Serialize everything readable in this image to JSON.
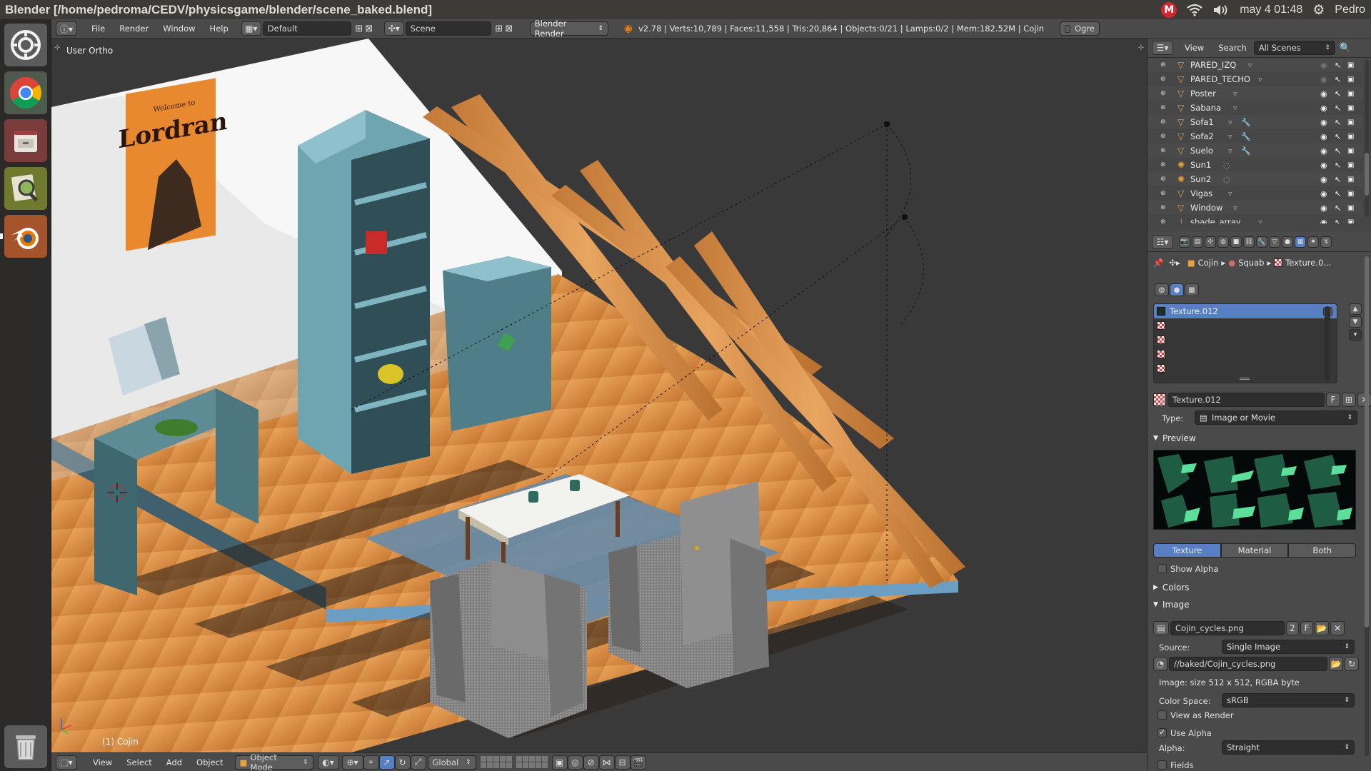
{
  "os_bar": {
    "window_title": "Blender [/home/pedroma/CEDV/physicsgame/blender/scene_baked.blend]",
    "mail_indicator": "M",
    "clock": "may  4 01:48",
    "user": "Pedro"
  },
  "launcher": {
    "items": [
      {
        "name": "ubuntu-settings",
        "icon": "gear-circle-icon"
      },
      {
        "name": "chrome",
        "icon": "chrome-icon"
      },
      {
        "name": "file-manager",
        "icon": "drawer-icon"
      },
      {
        "name": "image-viewer",
        "icon": "magnifier-icon"
      },
      {
        "name": "blender",
        "icon": "blender-icon"
      },
      {
        "name": "trash",
        "icon": "trash-icon"
      }
    ]
  },
  "info_header": {
    "menus": [
      "File",
      "Render",
      "Window",
      "Help"
    ],
    "layout": "Default",
    "scene": "Scene",
    "engine": "Blender Render",
    "stats": "v2.78 | Verts:10,789 | Faces:11,558 | Tris:20,864 | Objects:0/21 | Lamps:0/2 | Mem:182.52M | Cojin",
    "ogre_label": "Ogre"
  },
  "viewport": {
    "view_label": "User Ortho",
    "object_label": "(1) Cojin",
    "poster_text_small": "Welcome to",
    "poster_text": "Lordran"
  },
  "viewport_header": {
    "menus": [
      "View",
      "Select",
      "Add",
      "Object"
    ],
    "mode": "Object Mode",
    "orientation": "Global"
  },
  "outliner": {
    "menus": [
      "View",
      "Search"
    ],
    "filter": "All Scenes",
    "items": [
      {
        "name": "PARED_IZQ",
        "kind": "mesh",
        "modifier": false,
        "visible": false
      },
      {
        "name": "PARED_TECHO",
        "kind": "mesh",
        "modifier": false,
        "visible": false
      },
      {
        "name": "Poster",
        "kind": "mesh",
        "modifier": false,
        "visible": true
      },
      {
        "name": "Sabana",
        "kind": "mesh",
        "modifier": false,
        "visible": true
      },
      {
        "name": "Sofa1",
        "kind": "mesh",
        "modifier": true,
        "visible": true
      },
      {
        "name": "Sofa2",
        "kind": "mesh",
        "modifier": true,
        "visible": true
      },
      {
        "name": "Suelo",
        "kind": "mesh",
        "modifier": true,
        "visible": true
      },
      {
        "name": "Sun1",
        "kind": "lamp",
        "modifier": false,
        "visible": true
      },
      {
        "name": "Sun2",
        "kind": "lamp",
        "modifier": false,
        "visible": true
      },
      {
        "name": "Vigas",
        "kind": "mesh",
        "modifier": false,
        "visible": true
      },
      {
        "name": "Window",
        "kind": "mesh",
        "modifier": false,
        "visible": true
      },
      {
        "name": "shade_array",
        "kind": "empty",
        "modifier": false,
        "visible": true
      }
    ]
  },
  "properties": {
    "breadcrumb": [
      "Cojin",
      "Squab",
      "Texture.0..."
    ],
    "texture_slots": [
      "Texture.012",
      "",
      "",
      "",
      ""
    ],
    "texture_name": "Texture.012",
    "texture_fake_user": "F",
    "type_label": "Type:",
    "type_value": "Image or Movie",
    "preview_label": "Preview",
    "preview_tabs": [
      "Texture",
      "Material",
      "Both"
    ],
    "preview_active_tab": "Texture",
    "show_alpha_label": "Show Alpha",
    "colors_label": "Colors",
    "image_label": "Image",
    "image_name": "Cojin_cycles.png",
    "image_users": "2",
    "image_fake_user": "F",
    "source_label": "Source:",
    "source_value": "Single Image",
    "filepath": "//baked/Cojin_cycles.png",
    "image_info": "Image: size 512 x 512, RGBA byte",
    "colorspace_label": "Color Space:",
    "colorspace_value": "sRGB",
    "view_as_render_label": "View as Render",
    "view_as_render": false,
    "use_alpha_label": "Use Alpha",
    "use_alpha": true,
    "alpha_label": "Alpha:",
    "alpha_value": "Straight",
    "fields_label": "Fields",
    "fields": false
  },
  "colors": {
    "selection_blue": "#5680c2",
    "wood": "#d98a3f",
    "wall": "#ffffff",
    "background": "#393939",
    "furniture": "#7cb3bf"
  }
}
